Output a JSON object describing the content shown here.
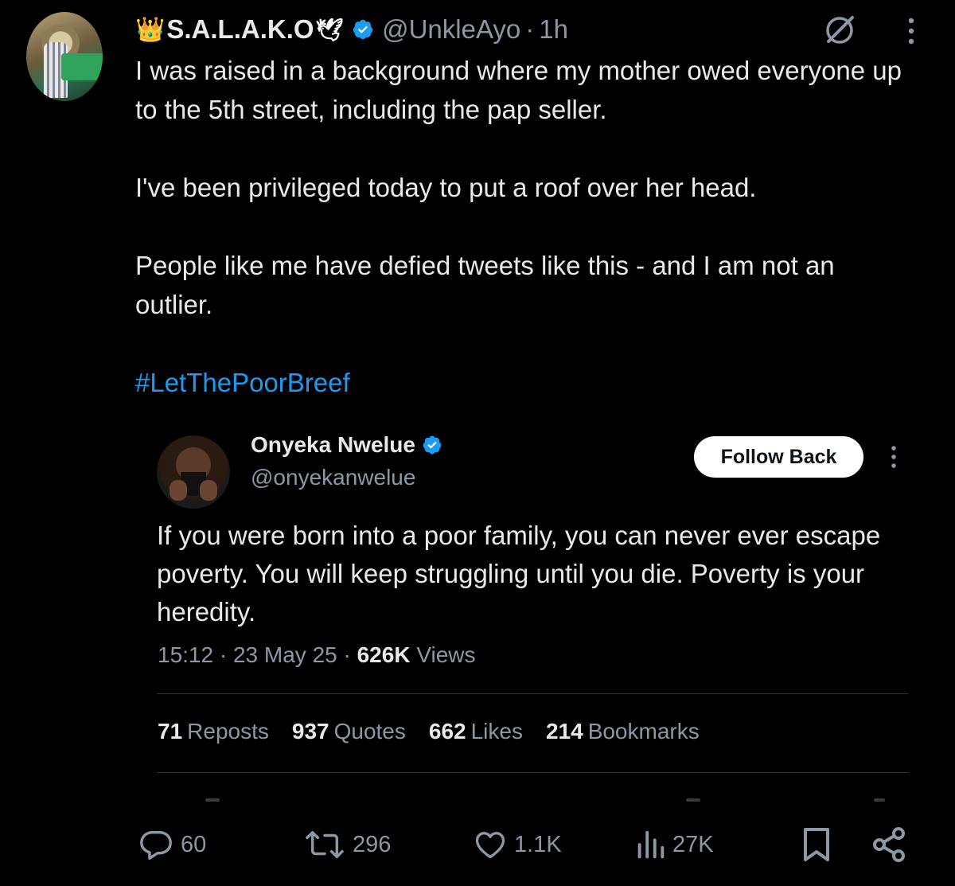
{
  "tweet": {
    "author": {
      "crown": "👑",
      "name": "S.A.L.A.K.O",
      "dove": "🕊",
      "handle": "@UnkleAyo",
      "separator": "·",
      "time": "1h",
      "verified": true
    },
    "paragraphs": [
      "I was raised in a background where my mother owed everyone up to the 5th street, including the pap seller.",
      "I've been privileged today to put a roof over her head.",
      "People like me have defied tweets like this - and I am not an outlier."
    ],
    "hashtag": "#LetThePoorBreef"
  },
  "quoted": {
    "author": {
      "name": "Onyeka Nwelue",
      "handle": "@onyekanwelue",
      "verified": true
    },
    "follow_label": "Follow Back",
    "text": "If you were born into a poor family, you can never ever escape poverty. You will keep struggling until you die. Poverty is your heredity.",
    "meta": {
      "time": "15:12",
      "sep1": " · ",
      "date": "23 May 25",
      "sep2": " · ",
      "views_count": "626K",
      "views_label": " Views"
    },
    "stats": [
      {
        "count": "71",
        "label": "Reposts"
      },
      {
        "count": "937",
        "label": "Quotes"
      },
      {
        "count": "662",
        "label": "Likes"
      },
      {
        "count": "214",
        "label": "Bookmarks"
      }
    ]
  },
  "actions": {
    "replies": "60",
    "reposts": "296",
    "likes": "1.1K",
    "views": "27K"
  },
  "icons": {
    "verified": "verified-badge-icon",
    "grok": "grok-icon",
    "more": "more-vertical-icon",
    "reply": "reply-icon",
    "repost": "repost-icon",
    "like": "heart-icon",
    "views": "analytics-icon",
    "bookmark": "bookmark-icon",
    "share": "share-icon"
  },
  "colors": {
    "background": "#000000",
    "text": "#e7e9ea",
    "muted": "#8b98a5",
    "accent": "#1d9bf0",
    "divider": "#2f3336"
  }
}
